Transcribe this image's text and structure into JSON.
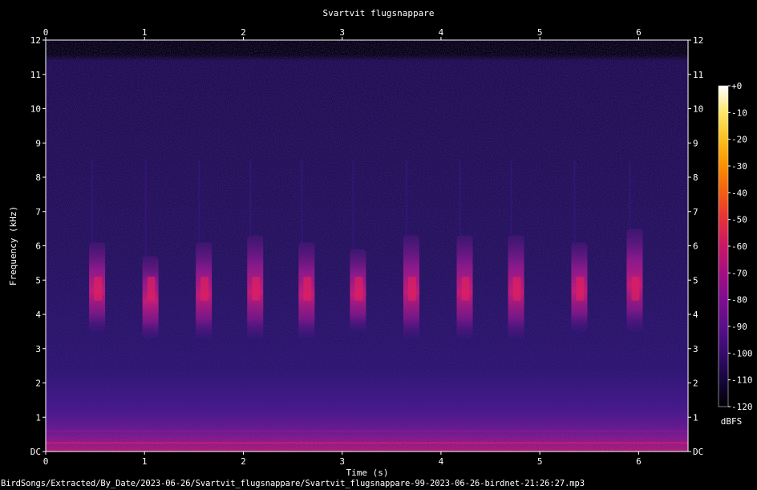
{
  "chart_data": {
    "type": "heatmap",
    "title": "Svartvit flugsnappare",
    "xlabel": "Time (s)",
    "ylabel": "Frequency (kHz)",
    "xlim": [
      0,
      6.5
    ],
    "ylim": [
      0,
      12
    ],
    "x_ticks": [
      "0",
      "1",
      "2",
      "3",
      "4",
      "5",
      "6"
    ],
    "y_ticks": [
      "DC",
      "1",
      "2",
      "3",
      "4",
      "5",
      "6",
      "7",
      "8",
      "9",
      "10",
      "11",
      "12"
    ],
    "colorbar": {
      "label": "dBFS",
      "range": [
        -120,
        0
      ],
      "ticks": [
        "+0",
        "-10",
        "-20",
        "-30",
        "-40",
        "-50",
        "-60",
        "-70",
        "-80",
        "-90",
        "-100",
        "-110",
        "-120"
      ],
      "colors": [
        "#000000",
        "#16063d",
        "#360b6e",
        "#5a0f8a",
        "#7e0d8e",
        "#a30f83",
        "#c91765",
        "#e5303a",
        "#f45d12",
        "#f98f00",
        "#fbbf1e",
        "#fde86a",
        "#ffffff"
      ]
    },
    "calls": [
      {
        "t": 0.52,
        "f_low": 3.5,
        "f_high": 6.1
      },
      {
        "t": 1.06,
        "f_low": 3.3,
        "f_high": 5.7
      },
      {
        "t": 1.6,
        "f_low": 3.3,
        "f_high": 6.1
      },
      {
        "t": 2.12,
        "f_low": 3.3,
        "f_high": 6.3
      },
      {
        "t": 2.64,
        "f_low": 3.3,
        "f_high": 6.1
      },
      {
        "t": 3.16,
        "f_low": 3.5,
        "f_high": 5.9
      },
      {
        "t": 3.7,
        "f_low": 3.3,
        "f_high": 6.3
      },
      {
        "t": 4.24,
        "f_low": 3.3,
        "f_high": 6.3
      },
      {
        "t": 4.76,
        "f_low": 3.3,
        "f_high": 6.3
      },
      {
        "t": 5.4,
        "f_low": 3.5,
        "f_high": 6.1
      },
      {
        "t": 5.96,
        "f_low": 3.5,
        "f_high": 6.5
      }
    ]
  },
  "footer": {
    "path": "BirdSongs/Extracted/By_Date/2023-06-26/Svartvit_flugsnappare/Svartvit_flugsnappare-99-2023-06-26-birdnet-21:26:27.mp3"
  }
}
